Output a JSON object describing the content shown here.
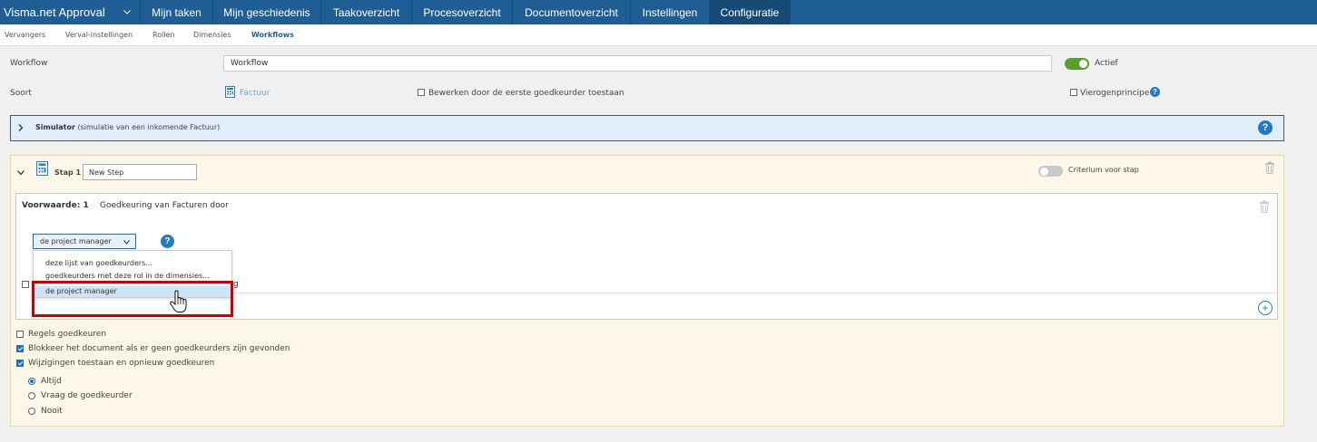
{
  "topnav": {
    "brand": "Visma.net Approval",
    "items": [
      {
        "label": "Mijn taken",
        "active": false
      },
      {
        "label": "Mijn geschiedenis",
        "active": false
      },
      {
        "label": "Taakoverzicht",
        "active": false
      },
      {
        "label": "Procesoverzicht",
        "active": false
      },
      {
        "label": "Documentoverzicht",
        "active": false
      },
      {
        "label": "Instellingen",
        "active": false
      },
      {
        "label": "Configuratie",
        "active": true
      }
    ]
  },
  "subnav": {
    "items": [
      {
        "label": "Vervangers",
        "active": false
      },
      {
        "label": "Verval-instellingen",
        "active": false
      },
      {
        "label": "Rollen",
        "active": false
      },
      {
        "label": "Dimensies",
        "active": false
      },
      {
        "label": "Workflows",
        "active": true
      }
    ]
  },
  "form": {
    "workflow_label": "Workflow",
    "workflow_value": "Workflow",
    "actief_label": "Actief",
    "actief_on": true,
    "soort_label": "Soort",
    "soort_value": "Factuur",
    "edit_first_label": "Bewerken door de eerste goedkeurder toestaan",
    "edit_first_checked": false,
    "vier_label": "Vierogenprincipe",
    "vier_checked": false
  },
  "simulator": {
    "title": "Simulator",
    "subtitle": "(simulatie van een inkomende Factuur)"
  },
  "step": {
    "label": "Stap 1 :",
    "name": "New Step",
    "criterium_label": "Criterium voor stap",
    "criterium_on": false,
    "condition": {
      "title": "Voorwaarde: 1",
      "description": "Goedkeuring van Facturen door",
      "selected": "de project manager",
      "hidden_text_tail": "g",
      "dropdown_options": [
        "deze lijst van goedkeurders...",
        "goedkeurders met deze rol in de dimensies...",
        "de project manager"
      ]
    },
    "options": [
      {
        "label": "Regels goedkeuren",
        "checked": false
      },
      {
        "label": "Blokkeer het document als er geen goedkeurders zijn gevonden",
        "checked": true
      },
      {
        "label": "Wijzigingen toestaan en opnieuw goedkeuren",
        "checked": true
      }
    ],
    "radios": [
      {
        "label": "Altijd",
        "checked": true
      },
      {
        "label": "Vraag de goedkeurder",
        "checked": false
      },
      {
        "label": "Nooit",
        "checked": false
      }
    ]
  },
  "colors": {
    "nav": "#1f5e95",
    "nav_active": "#164a77",
    "accent": "#1f7bc8",
    "toggle_on": "#5aa02c",
    "highlight_box": "#d00000"
  }
}
